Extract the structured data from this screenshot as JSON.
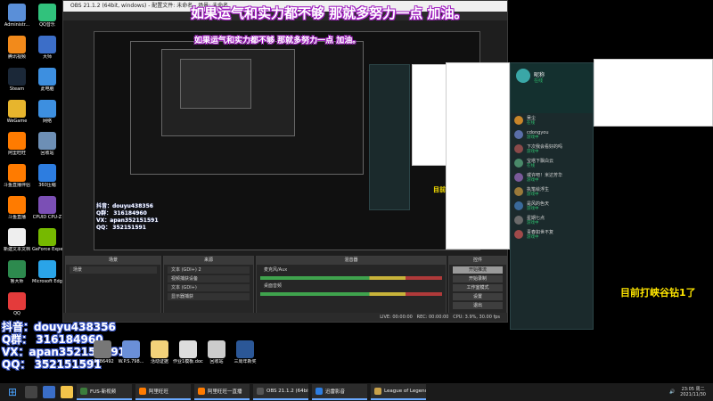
{
  "desktop": {
    "icons": [
      {
        "label": "Administr...",
        "color": "#5a8fd8"
      },
      {
        "label": "QQ音乐",
        "color": "#31c27c"
      },
      {
        "label": "腾讯视频",
        "color": "#f28a1b"
      },
      {
        "label": "大师",
        "color": "#3c6ec8"
      },
      {
        "label": "Steam",
        "color": "#1b2838"
      },
      {
        "label": "此电脑",
        "color": "#3d8fe0"
      },
      {
        "label": "WeGame",
        "color": "#e7b52d"
      },
      {
        "label": "网络",
        "color": "#3d8fe0"
      },
      {
        "label": "阿里旺旺",
        "color": "#ff7b00"
      },
      {
        "label": "回收站",
        "color": "#6d8fb5"
      },
      {
        "label": "斗鱼直播伴侣",
        "color": "#ff7b00"
      },
      {
        "label": "360压缩",
        "color": "#2d7de0"
      },
      {
        "label": "斗鱼直播",
        "color": "#ff7b00"
      },
      {
        "label": "CPUID CPU-Z",
        "color": "#7b4fb5"
      },
      {
        "label": "新建文本文档",
        "color": "#eeeeee"
      },
      {
        "label": "GeForce Experience",
        "color": "#76b900"
      },
      {
        "label": "鲁大师",
        "color": "#2d8a4e"
      },
      {
        "label": "Microsoft Edge",
        "color": "#2aa4e8"
      },
      {
        "label": "QQ",
        "color": "#e43b3b"
      }
    ],
    "row_icons": [
      {
        "label": "16886492",
        "color": "#777777"
      },
      {
        "label": "W.P.S.798...",
        "color": "#6a8fd8"
      },
      {
        "label": "活动证据",
        "color": "#f3d27a"
      },
      {
        "label": "作业1模板.docx",
        "color": "#dddddd"
      },
      {
        "label": "回收站",
        "color": "#cccccc"
      },
      {
        "label": "三周年新奖",
        "color": "#2b5797"
      }
    ]
  },
  "obs": {
    "title": "OBS 21.1.2 (64bit, windows) - 配置文件: 未命名 - 场景: 未命名",
    "docks": {
      "scenes": {
        "title": "场景",
        "items": [
          "场景"
        ]
      },
      "sources": {
        "title": "来源",
        "items": [
          "文本 (GDI+) 2",
          "视频捕获设备",
          "文本 (GDI+)",
          "显示器捕获"
        ]
      },
      "mixer": {
        "title": "混音器",
        "items": [
          "麦克风/Aux",
          "桌面音频"
        ]
      },
      "controls": {
        "title": "控件",
        "buttons": [
          "开始推流",
          "开始录制",
          "工作室模式",
          "设置",
          "退出"
        ]
      }
    },
    "status": {
      "live": "LIVE: 00:00:00",
      "rec": "REC: 00:00:00",
      "cpu": "CPU: 3.9%, 30.00 fps"
    }
  },
  "overlay": {
    "banner": "如果运气和实力都不够 那就多努力一点 加油。",
    "yellow_caption": "目前打峡谷钻1了",
    "stream_info": [
      "抖音：douyu438356",
      "Q群： 316184960",
      "VX：apan352151591",
      "QQ：  352151591"
    ]
  },
  "client": {
    "username": "昵称",
    "status_text": "在线",
    "friends": [
      {
        "name": "吴尘",
        "status": "在线",
        "color": "#c9862a"
      },
      {
        "name": "cdongyou",
        "status": "游戏中",
        "color": "#5a6fa8"
      },
      {
        "name": "下次我会看好的吗",
        "status": "游戏中",
        "color": "#8a4a4a"
      },
      {
        "name": "宝塔下飘白云",
        "status": "在线",
        "color": "#4a8a6a"
      },
      {
        "name": "或许吧！米达芳华",
        "status": "游戏中",
        "color": "#7a5a9a"
      },
      {
        "name": "执笔绘浮生",
        "status": "游戏中",
        "color": "#9a7a3a"
      },
      {
        "name": "是风的色天",
        "status": "游戏中",
        "color": "#3a6a9a"
      },
      {
        "name": "星期七点",
        "status": "游戏中",
        "color": "#6a6a6a"
      },
      {
        "name": "青春如世不复",
        "status": "游戏中",
        "color": "#a04a4a"
      }
    ]
  },
  "taskbar": {
    "tasks": [
      {
        "label": "FUS-新视频",
        "color": "#3c7d3c"
      },
      {
        "label": "阿里旺旺",
        "color": "#ff7b00"
      },
      {
        "label": "阿里旺旺一直播",
        "color": "#ff7b00"
      },
      {
        "label": "OBS 21.1.2 (64bit...",
        "color": "#555555"
      },
      {
        "label": "迅雷影音",
        "color": "#2d7de0"
      },
      {
        "label": "League of Legends",
        "color": "#c8a14a"
      }
    ],
    "tray": {
      "time": "23:05",
      "weekday": "周二",
      "date": "2021/11/30"
    }
  },
  "colors": {
    "accent": "#ffe600",
    "banner_stroke": "#a020c0",
    "overlay_stroke": "#3a57c8"
  }
}
